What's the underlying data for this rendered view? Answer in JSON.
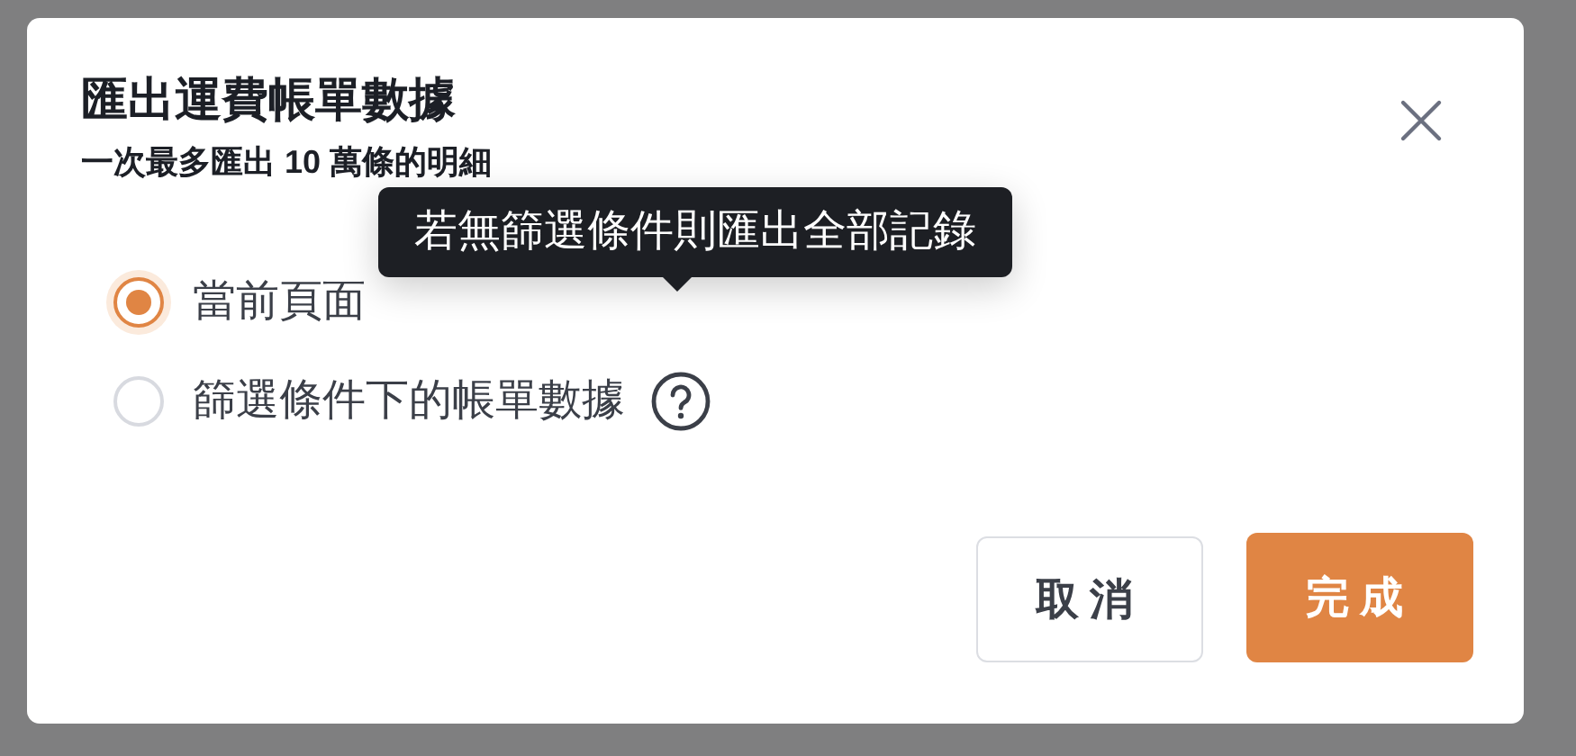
{
  "dialog": {
    "title": "匯出運費帳單數據",
    "subtitle": "一次最多匯出 10 萬條的明細"
  },
  "options": [
    {
      "label": "當前頁面",
      "selected": true,
      "help": false
    },
    {
      "label": "篩選條件下的帳單數據",
      "selected": false,
      "help": true
    }
  ],
  "tooltip": "若無篩選條件則匯出全部記錄",
  "buttons": [
    {
      "label": "取消",
      "kind": "secondary"
    },
    {
      "label": "完成",
      "kind": "primary"
    }
  ]
}
